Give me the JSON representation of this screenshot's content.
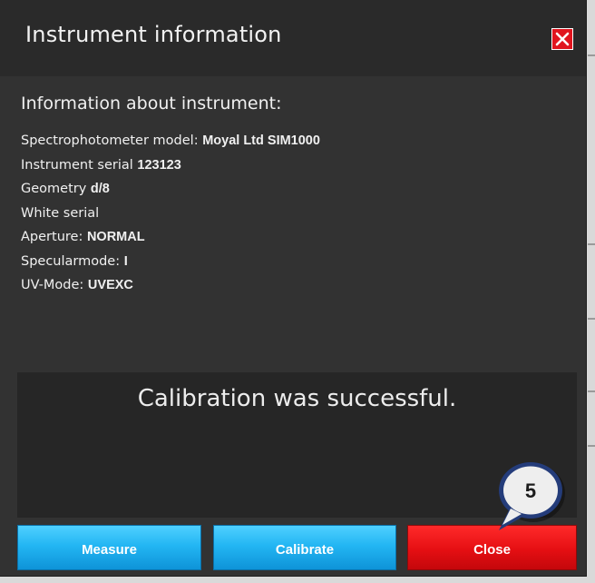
{
  "dialog": {
    "title": "Instrument information",
    "close_icon": "close-icon",
    "info_heading": "Information about instrument:",
    "rows": [
      {
        "label": "Spectrophotometer model: ",
        "value": "Moyal Ltd SIM1000"
      },
      {
        "label": "Instrument serial ",
        "value": "123123"
      },
      {
        "label": "Geometry ",
        "value": "d/8"
      },
      {
        "label": "White serial",
        "value": ""
      },
      {
        "label": "Aperture: ",
        "value": "NORMAL"
      },
      {
        "label": "Specularmode: ",
        "value": "I"
      },
      {
        "label": "UV-Mode: ",
        "value": "UVEXC"
      }
    ],
    "status_message": "Calibration was successful."
  },
  "buttons": {
    "measure": "Measure",
    "calibrate": "Calibrate",
    "close": "Close"
  },
  "callout": {
    "number": "5"
  },
  "colors": {
    "dialog_bg": "#323232",
    "titlebar_bg": "#2a2a2a",
    "status_bg": "#262626",
    "blue_button": "#23b6f3",
    "red_button": "#e50f13",
    "callout_fill": "#eeeeee",
    "callout_border": "#243c7a"
  }
}
